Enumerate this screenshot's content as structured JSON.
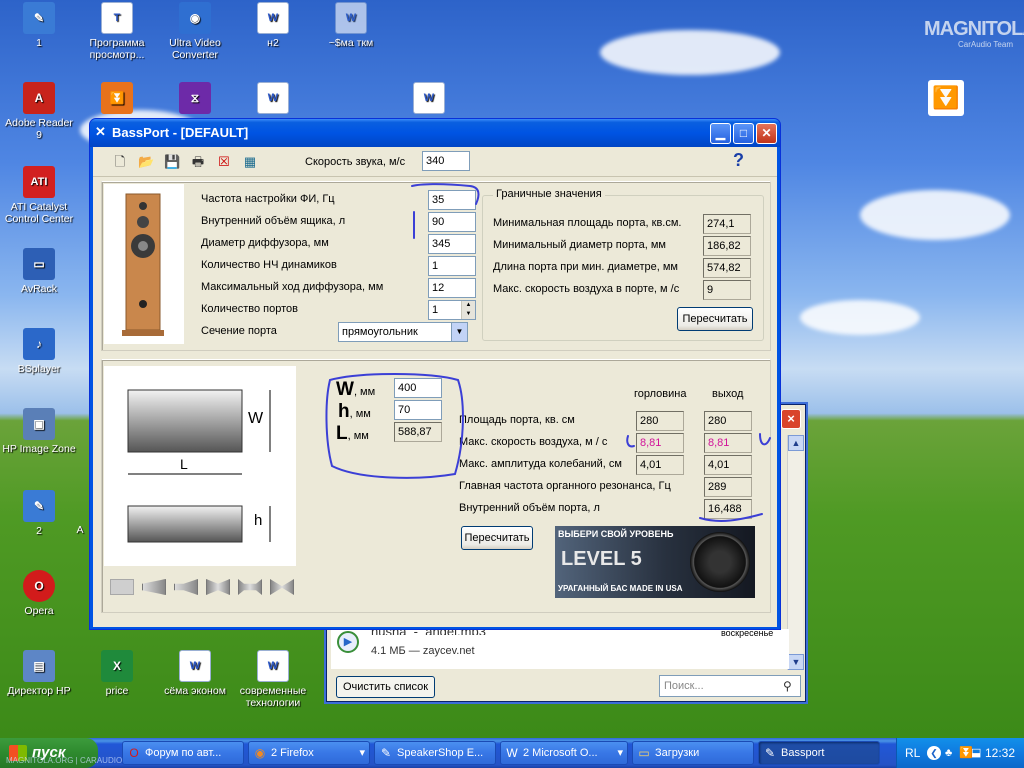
{
  "desktop": {
    "icons": [
      {
        "label": "1",
        "glyph": "✎",
        "color": "#3a7bd5"
      },
      {
        "label": "Программа просмотр...",
        "glyph": "T",
        "color": "#f0f0f0"
      },
      {
        "label": "Ultra Video Converter",
        "glyph": "◉",
        "color": "#2f6fd1"
      },
      {
        "label": "н2",
        "glyph": "W",
        "color": "#fff"
      },
      {
        "label": "~$ма ткм",
        "glyph": "W",
        "color": "#fff"
      },
      {
        "label": "Adobe Reader 9",
        "glyph": "A",
        "color": "#c8231b"
      },
      {
        "label": "ATI Catalyst Control Center",
        "glyph": "ATI",
        "color": "#d22020"
      },
      {
        "label": "AvRack",
        "glyph": "▭",
        "color": "#2d5fb5"
      },
      {
        "label": "BSplayer",
        "glyph": "♪",
        "color": "#2b68c9"
      },
      {
        "label": "HP Image Zone",
        "glyph": "▣",
        "color": "#5a7fb7"
      },
      {
        "label": "2",
        "glyph": "✎",
        "color": "#3a7bd5"
      },
      {
        "label": "Opera",
        "glyph": "O",
        "color": "#d21b1b"
      },
      {
        "label": "Директор HP",
        "glyph": "▤",
        "color": "#5d86c6"
      },
      {
        "label": "price",
        "glyph": "X",
        "color": "#1f8a3b"
      },
      {
        "label": "сёма эконом",
        "glyph": "W",
        "color": "#fff"
      },
      {
        "label": "современные технологии",
        "glyph": "W",
        "color": "#fff"
      }
    ],
    "brand": "MAGNITOLA",
    "brand_sub": "CarAudio Team",
    "partial_label": "A"
  },
  "downloads": {
    "file": "nusha_-_angel.mp3",
    "size": "4.1 МБ — zaycev.net",
    "day": "воскресенье",
    "clear_button": "Очистить список",
    "search_placeholder": "Поиск..."
  },
  "window": {
    "title": "BassPort - [DEFAULT]",
    "help": "?",
    "sound_speed_label": "Скорость звука, м/с",
    "sound_speed": "340",
    "params": [
      {
        "label": "Частота настройки ФИ, Гц",
        "value": "35"
      },
      {
        "label": "Внутренний объём ящика, л",
        "value": "90"
      },
      {
        "label": "Диаметр диффузора, мм",
        "value": "345"
      },
      {
        "label": "Количество НЧ динамиков",
        "value": "1"
      },
      {
        "label": "Максимальный ход диффузора, мм",
        "value": "12"
      },
      {
        "label": "Количество портов",
        "value": "1"
      },
      {
        "label": "Сечение порта",
        "value": "прямоугольник"
      }
    ],
    "limits": {
      "title": "Граничные значения",
      "rows": [
        {
          "label": "Минимальная площадь порта, кв.см.",
          "value": "274,1"
        },
        {
          "label": "Минимальный диаметр порта, мм",
          "value": "186,82"
        },
        {
          "label": "Длина порта при мин. диаметре, мм",
          "value": "574,82"
        },
        {
          "label": "Макс. скорость воздуха в порте, м /с",
          "value": "9"
        }
      ],
      "recalc": "Пересчитать"
    },
    "dims": [
      {
        "sym": "W",
        "unit": ", мм",
        "value": "400"
      },
      {
        "sym": "h",
        "unit": ", мм",
        "value": "70"
      },
      {
        "sym": "L",
        "unit": ", мм",
        "value": "588,87"
      }
    ],
    "diagram": {
      "w": "W",
      "l": "L",
      "h": "h"
    },
    "col_headers": [
      "горловина",
      "выход"
    ],
    "results": [
      {
        "label": "Площадь порта, кв. см",
        "a": "280",
        "b": "280"
      },
      {
        "label": "Макс. скорость воздуха, м / с",
        "a": "8,81",
        "b": "8,81"
      },
      {
        "label": "Макс. амплитуда колебаний, см",
        "a": "4,01",
        "b": "4,01"
      },
      {
        "label": "Главная частота органного резонанса, Гц",
        "a": "289"
      },
      {
        "label": "Внутренний объём порта, л",
        "a": "16,488"
      }
    ],
    "recalc2": "Пересчитать",
    "ad": {
      "line1": "ВЫБЕРИ СВОЙ УРОВЕНЬ",
      "line2": "LEVEL 5",
      "line3": "УРАГАННЫЙ БАС MADE IN USA"
    }
  },
  "taskbar": {
    "start": "пуск",
    "tasks": [
      {
        "label": "Форум по авт...",
        "glyph": "O"
      },
      {
        "label": "2 Firefox",
        "glyph": "◉"
      },
      {
        "label": "SpeakerShop E...",
        "glyph": "✎"
      },
      {
        "label": "2 Microsoft O...",
        "glyph": "W"
      },
      {
        "label": "Загрузки",
        "glyph": "▭"
      },
      {
        "label": "Bassport",
        "glyph": "✎"
      }
    ],
    "lang": "RL",
    "time": "12:32",
    "watermark": "MAGNITOLA.ORG | CARAUDIO TEAM"
  },
  "colors": {
    "accent": "#0054e3",
    "annotation": "#3b3fd6",
    "highlight": "#d1149a"
  }
}
